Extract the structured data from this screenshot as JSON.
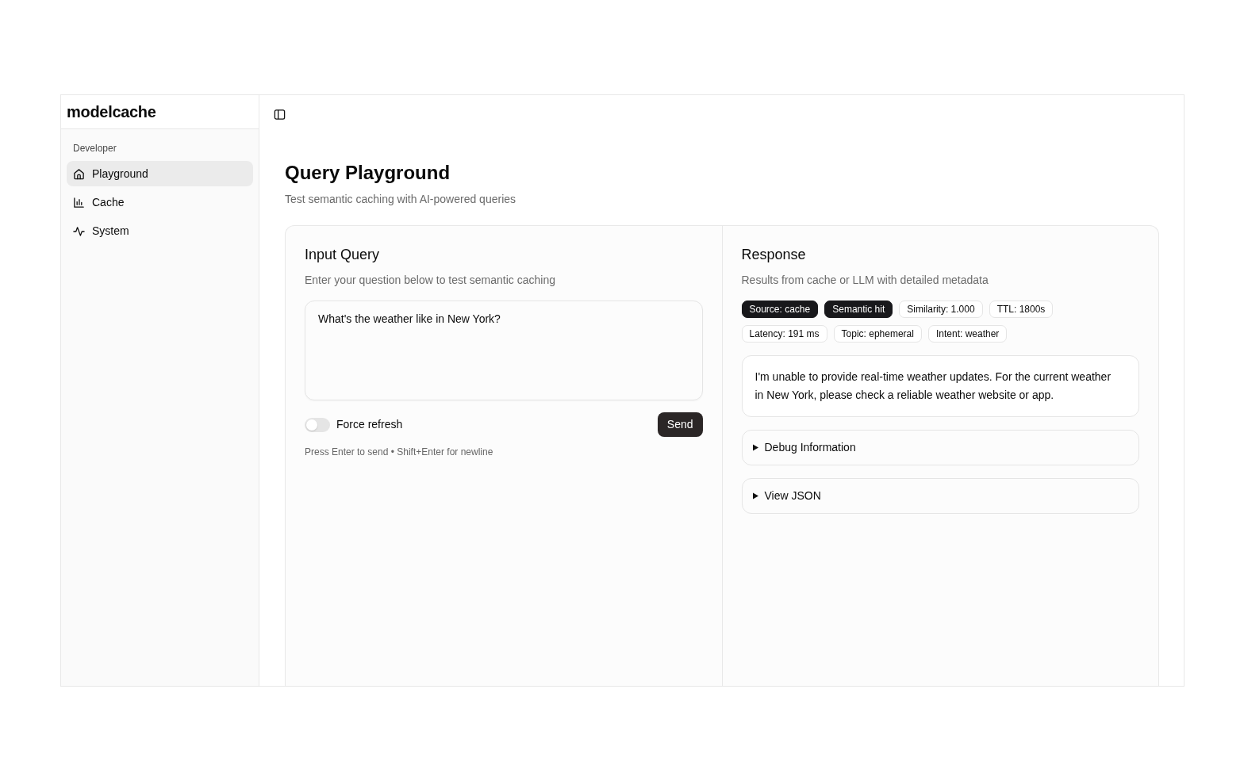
{
  "sidebar": {
    "brand": "modelcache",
    "group_label": "Developer",
    "items": [
      {
        "label": "Playground",
        "selected": true
      },
      {
        "label": "Cache",
        "selected": false
      },
      {
        "label": "System",
        "selected": false
      }
    ]
  },
  "page": {
    "title": "Query Playground",
    "subtitle": "Test semantic caching with AI-powered queries"
  },
  "input_panel": {
    "title": "Input Query",
    "description": "Enter your question below to test semantic caching",
    "query": "What's the weather like in New York?",
    "force_refresh": {
      "label": "Force refresh",
      "on": false
    },
    "send_button": "Send",
    "hint": "Press Enter to send • Shift+Enter for newline"
  },
  "response_panel": {
    "title": "Response",
    "description": "Results from cache or LLM with detailed metadata",
    "badges": [
      {
        "label": "Source: cache",
        "kind": "solid"
      },
      {
        "label": "Semantic hit",
        "kind": "solid"
      },
      {
        "label": "Similarity: 1.000",
        "kind": "outline"
      },
      {
        "label": "TTL: 1800s",
        "kind": "outline"
      },
      {
        "label": "Latency: 191 ms",
        "kind": "outline"
      },
      {
        "label": "Topic: ephemeral",
        "kind": "outline"
      },
      {
        "label": "Intent: weather",
        "kind": "outline"
      }
    ],
    "answer": "I'm unable to provide real-time weather updates. For the current weather in New York, please check a reliable weather website or app.",
    "sections": [
      {
        "label": "Debug Information",
        "expanded": false
      },
      {
        "label": "View JSON",
        "expanded": false
      }
    ]
  }
}
